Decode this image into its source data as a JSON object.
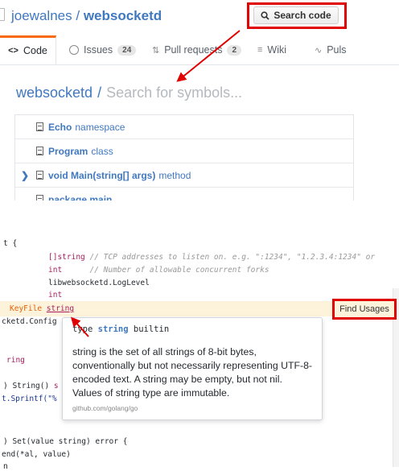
{
  "repo": {
    "owner": "joewalnes",
    "separator": "/",
    "name": "websocketd"
  },
  "search_button": {
    "label": "Search code",
    "icon": "search-icon"
  },
  "tabs": [
    {
      "label": "Code",
      "glyph": "<>"
    },
    {
      "label": "Issues",
      "count": "24",
      "glyph": "!"
    },
    {
      "label": "Pull requests",
      "count": "2",
      "glyph": "⇅"
    },
    {
      "label": "Wiki",
      "glyph": "≡"
    },
    {
      "label": "Puls",
      "glyph": "∿"
    }
  ],
  "symbol_search": {
    "repo": "websocketd",
    "separator": "/",
    "placeholder": "Search for symbols..."
  },
  "symbols": [
    {
      "name": "Echo",
      "kind": "namespace"
    },
    {
      "name": "Program",
      "kind": "class"
    },
    {
      "name": "void Main(string[] args)",
      "kind": "method",
      "chevron": "❯"
    },
    {
      "name": "package main",
      "kind": ""
    }
  ],
  "code_lines": {
    "l1": "t {",
    "l2a": "[]string",
    "l2b": " // TCP addresses to listen on. e.g. \":1234\", \"1.2.3.4:1234\" or",
    "l3a": "int",
    "l3b": "      // Number of allowable concurrent forks",
    "l4": "libwebsocketd.LogLevel",
    "l5": "int",
    "l6a": "KeyFile ",
    "l6b": "string",
    "l7": "cketd.Config",
    "l8": "ring",
    "l9a": ") String() ",
    "l9b": "s",
    "l10": "t.Sprintf(\"%",
    "l11": ") Set(value string) error {",
    "l12": "end(*al, value)",
    "l13": "n"
  },
  "find_usages": {
    "label": "Find Usages"
  },
  "tooltip": {
    "sig_type": "type",
    "sig_name": "string",
    "sig_kind": "builtin",
    "description": "string is the set of all strings of 8-bit bytes, conventionally but not necessarily representing UTF-8-encoded text. A string may be empty, but not nil. Values of string type are immutable.",
    "source": "github.com/golang/go"
  }
}
